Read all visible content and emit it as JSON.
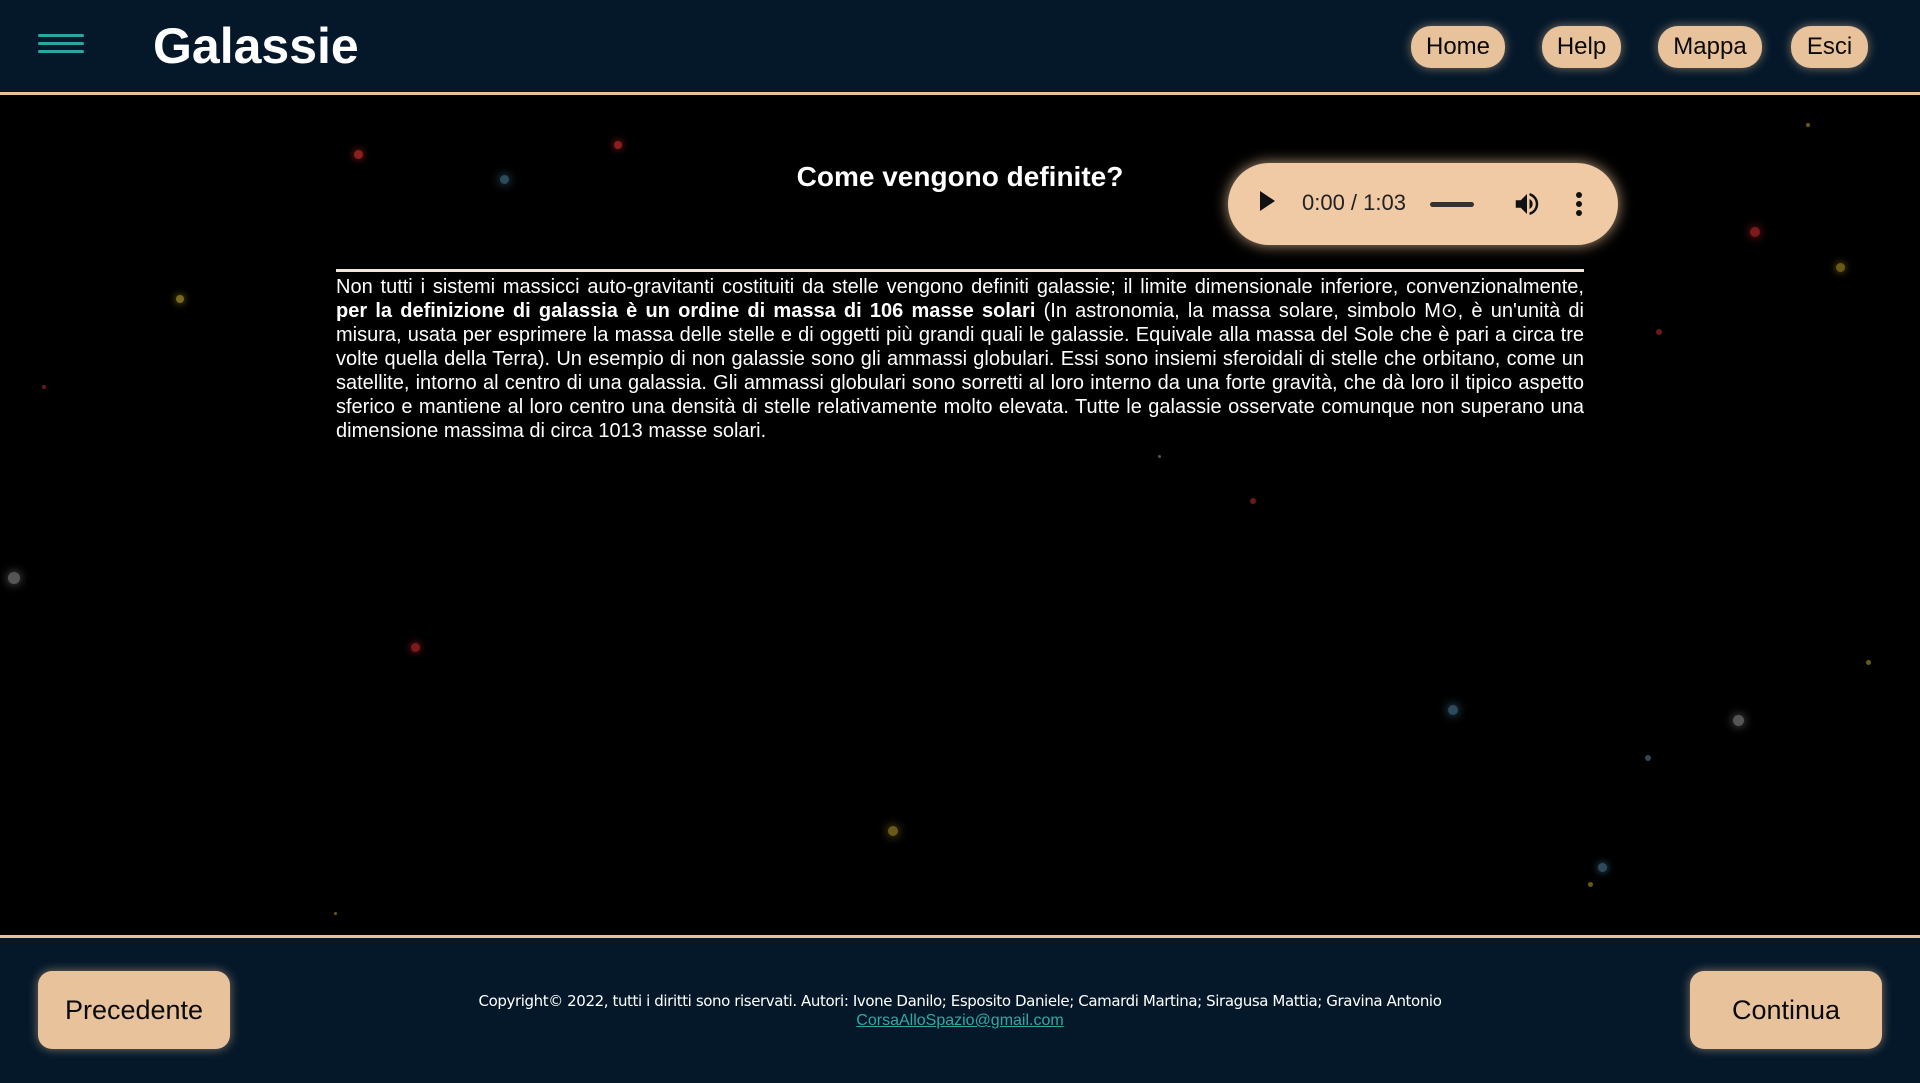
{
  "header": {
    "title": "Galassie",
    "nav": [
      "Home",
      "Help",
      "Mappa",
      "Esci"
    ]
  },
  "content": {
    "section_title": "Come vengono definite?",
    "audio": {
      "time": "0:00 / 1:03"
    },
    "paragraph": {
      "part1": "Non tutti i sistemi massicci auto-gravitanti costituiti da stelle vengono definiti galassie; il limite dimensionale inferiore, convenzionalmente, ",
      "bold": "per la definizione di galassia è un ordine di massa di 106 masse solari",
      "part2": " (In astronomia, la massa solare, simbolo M⊙, è un'unità di misura, usata per esprimere la massa delle stelle e di oggetti più grandi quali le galassie. Equivale alla massa del Sole che è pari a circa tre volte quella della Terra). Un esempio di non galassie sono gli ammassi globulari. Essi sono insiemi sferoidali di stelle che orbitano, come un satellite, intorno al centro di una galassia. Gli ammassi globulari sono sorretti al loro interno da una forte gravità, che dà loro il tipico aspetto sferico e mantiene al loro centro una densità di stelle relativamente molto elevata. Tutte le galassie osservate comunque non superano una dimensione massima di circa 1013 masse solari."
    }
  },
  "footer": {
    "prev": "Precedente",
    "next": "Continua",
    "copyright": "Copyright© 2022, tutti i diritti sono riservati. Autori: Ivone Danilo; Esposito Daniele; Camardi Martina; Siragusa Mattia; Gravina Antonio",
    "email": "CorsaAlloSpazio@gmail.com"
  },
  "colors": {
    "bar_bg": "#05182a",
    "accent": "#e8c29a",
    "hamburger": "#29a7a3",
    "link": "#2fa9a3"
  }
}
